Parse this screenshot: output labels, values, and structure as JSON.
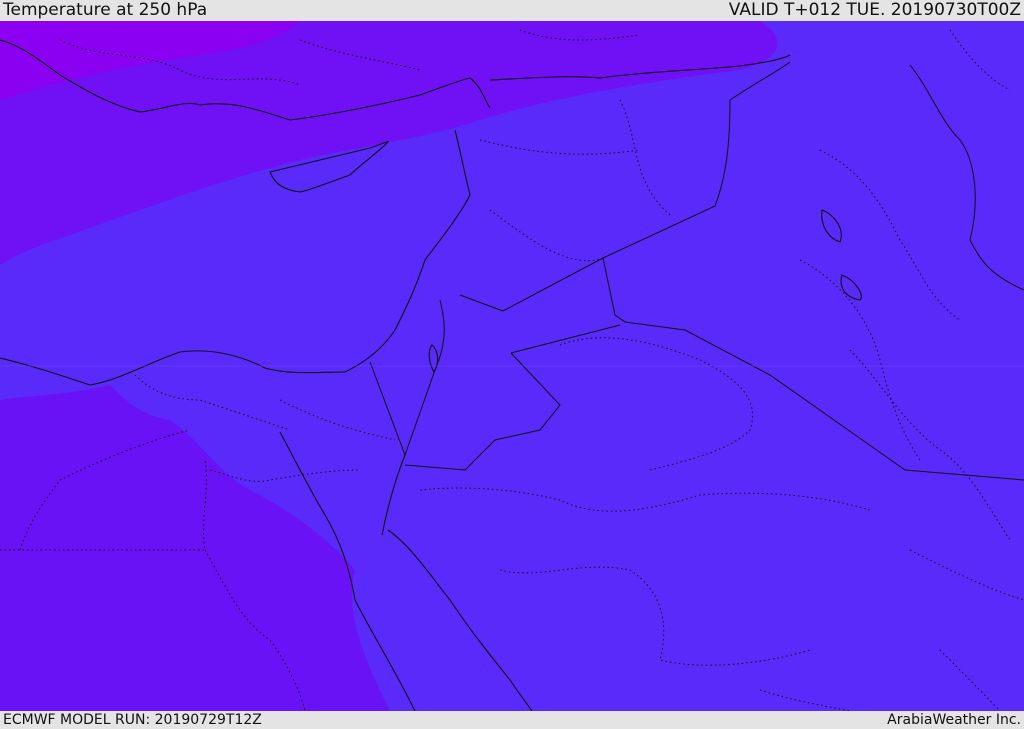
{
  "header": {
    "title": "Temperature at 250 hPa",
    "valid": "VALID T+012 TUE. 20190730T00Z"
  },
  "footer": {
    "model_run": "ECMWF MODEL RUN: 20190729T12Z",
    "credit": "ArabiaWeather Inc."
  },
  "colors": {
    "band_coldest": "#8a00f0",
    "band_cold": "#7010f4",
    "band_mid": "#6a12f6",
    "band_warm": "#5a2afa",
    "border": "#111111"
  }
}
